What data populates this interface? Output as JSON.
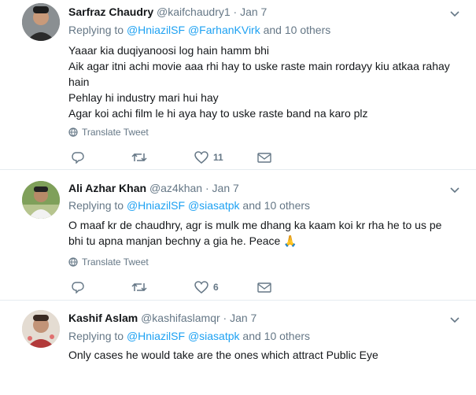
{
  "tweets": [
    {
      "name": "Sarfraz Chaudry",
      "handle": "@kaifchaudry1",
      "date": "· Jan 7",
      "replying_prefix": "Replying to",
      "replying_to": [
        "@HniazilSF",
        "@FarhanKVirk"
      ],
      "replying_suffix": "and 10 others",
      "lines": [
        "Yaaar kia duqiyanoosi log hain hamm bhi",
        "Aik agar itni achi movie aaa rhi hay to uske raste main rordayy kiu atkaa rahay hain",
        "Pehlay hi industry  mari hui hay",
        "Agar koi achi film le hi aya hay to uske raste band na karo plz"
      ],
      "translate": "Translate Tweet",
      "reply_count": "",
      "retweet_count": "",
      "like_count": "11"
    },
    {
      "name": "Ali Azhar Khan",
      "handle": "@az4khan",
      "date": "· Jan 7",
      "replying_prefix": "Replying to",
      "replying_to": [
        "@HniazilSF",
        "@siasatpk"
      ],
      "replying_suffix": "and 10 others",
      "lines": [
        "O maaf kr de chaudhry, agr is mulk me dhang ka kaam koi kr rha he to us pe bhi tu apna manjan bechny a gia he. Peace 🙏"
      ],
      "translate": "Translate Tweet",
      "reply_count": "",
      "retweet_count": "",
      "like_count": "6"
    },
    {
      "name": "Kashif Aslam",
      "handle": "@kashifaslamqr",
      "date": "· Jan 7",
      "replying_prefix": "Replying to",
      "replying_to": [
        "@HniazilSF",
        "@siasatpk"
      ],
      "replying_suffix": "and 10 others",
      "lines": [
        "Only cases he would take are the ones which attract Public Eye"
      ]
    }
  ],
  "colors": {
    "link": "#1da1f2",
    "meta": "#657786",
    "text": "#14171a",
    "divider": "#e6ecf0"
  },
  "icons": [
    "reply-icon",
    "retweet-icon",
    "like-icon",
    "dm-icon",
    "chevron-down-icon",
    "globe-icon"
  ]
}
